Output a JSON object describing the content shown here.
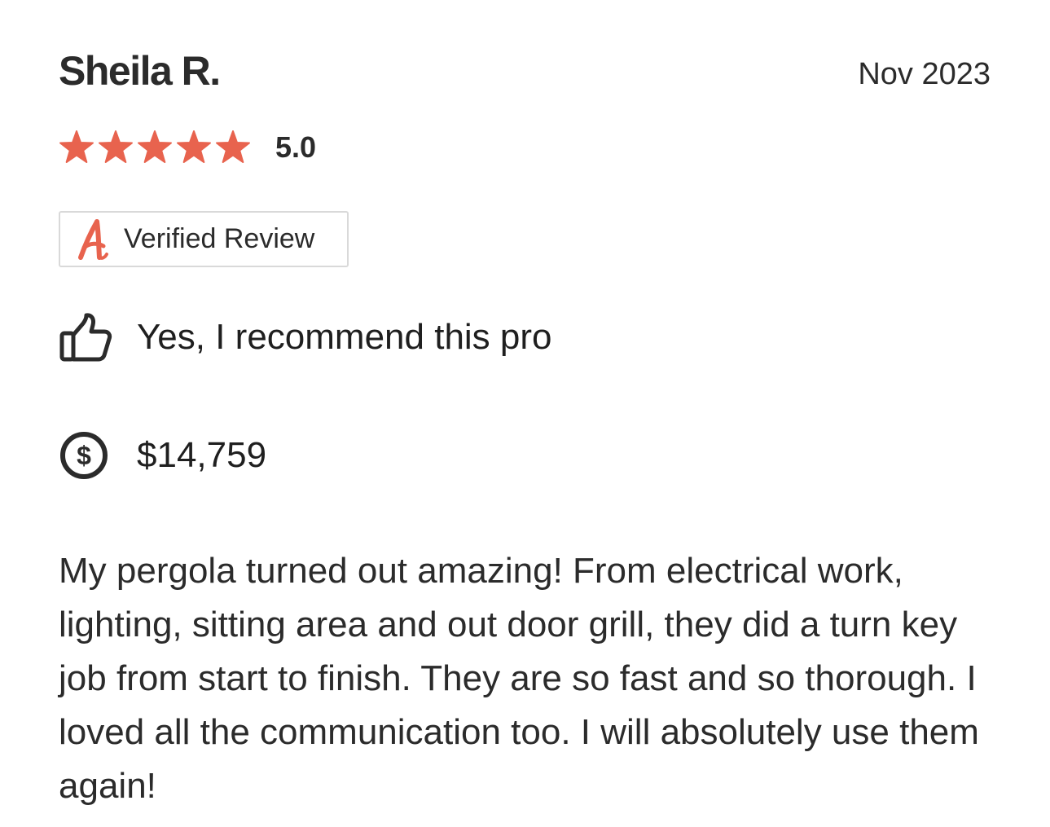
{
  "review": {
    "reviewer_name": "Sheila R.",
    "date": "Nov 2023",
    "rating": {
      "stars": 5,
      "max_stars": 5,
      "value_label": "5.0",
      "star_color": "#e8634e"
    },
    "badge": {
      "label": "Verified Review",
      "logo_icon": "angi-logo-icon",
      "logo_color": "#e8634e"
    },
    "recommend": {
      "icon": "thumbs-up-icon",
      "label": "Yes, I recommend this pro"
    },
    "cost": {
      "icon": "dollar-circle-icon",
      "amount": "$14,759"
    },
    "body": "My pergola turned out amazing! From electrical work, lighting, sitting area and out door grill, they did a turn key job from start to finish. They are so fast and so thorough. I loved all the communication too. I will absolutely use them again!"
  }
}
